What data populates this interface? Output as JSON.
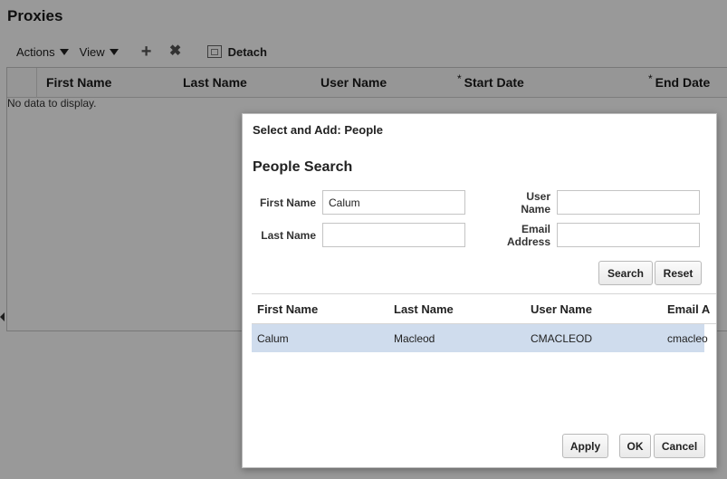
{
  "page": {
    "title": "Proxies",
    "toolbar": {
      "actions_label": "Actions",
      "view_label": "View",
      "add_icon": "+",
      "delete_icon": "✖",
      "detach_label": "Detach"
    },
    "grid": {
      "columns": [
        {
          "label": "First Name",
          "required": false
        },
        {
          "label": "Last Name",
          "required": false
        },
        {
          "label": "User Name",
          "required": false
        },
        {
          "label": "Start Date",
          "required": true
        },
        {
          "label": "End Date",
          "required": true
        }
      ],
      "required_mark": "*",
      "empty_text": "No data to display."
    }
  },
  "dialog": {
    "title": "Select and Add: People",
    "heading": "People Search",
    "fields": {
      "first_name": {
        "label": "First Name",
        "value": "Calum"
      },
      "last_name": {
        "label": "Last Name",
        "value": ""
      },
      "user_name": {
        "label_line1": "User",
        "label_line2": "Name",
        "value": ""
      },
      "email": {
        "label_line1": "Email",
        "label_line2": "Address",
        "value": ""
      }
    },
    "search_button": "Search",
    "reset_button": "Reset",
    "results": {
      "columns": [
        "First Name",
        "Last Name",
        "User Name",
        "Email A"
      ],
      "rows": [
        {
          "first_name": "Calum",
          "last_name": "Macleod",
          "user_name": "CMACLEOD",
          "email": "cmacleo"
        }
      ]
    },
    "apply_button": "Apply",
    "ok_button": "OK",
    "cancel_button": "Cancel"
  }
}
